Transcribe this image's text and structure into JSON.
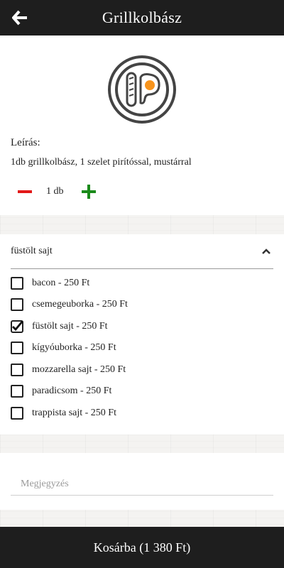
{
  "header": {
    "title": "Grillkolbász",
    "back_icon": "arrow-left-icon"
  },
  "product": {
    "logo_icon": "sausage-egg-plate-icon",
    "accent_color": "#f7941d",
    "description_label": "Leírás:",
    "description": "1db grillkolbász, 1 szelet pirítóssal, mustárral",
    "quantity": "1 db"
  },
  "extras": {
    "selected_summary": "füstölt sajt",
    "options": [
      {
        "label": "bacon - 250 Ft",
        "checked": false
      },
      {
        "label": "csemegeuborka - 250 Ft",
        "checked": false
      },
      {
        "label": "füstölt sajt - 250 Ft",
        "checked": true
      },
      {
        "label": "kígyóuborka - 250 Ft",
        "checked": false
      },
      {
        "label": "mozzarella sajt - 250 Ft",
        "checked": false
      },
      {
        "label": "paradicsom - 250 Ft",
        "checked": false
      },
      {
        "label": "trappista sajt - 250 Ft",
        "checked": false
      }
    ]
  },
  "note": {
    "placeholder": "Megjegyzés",
    "value": ""
  },
  "footer": {
    "cart_button": "Kosárba (1 380 Ft)"
  },
  "colors": {
    "bar": "#1e1e1e",
    "minus": "#e21818",
    "plus": "#1a8a1a"
  }
}
